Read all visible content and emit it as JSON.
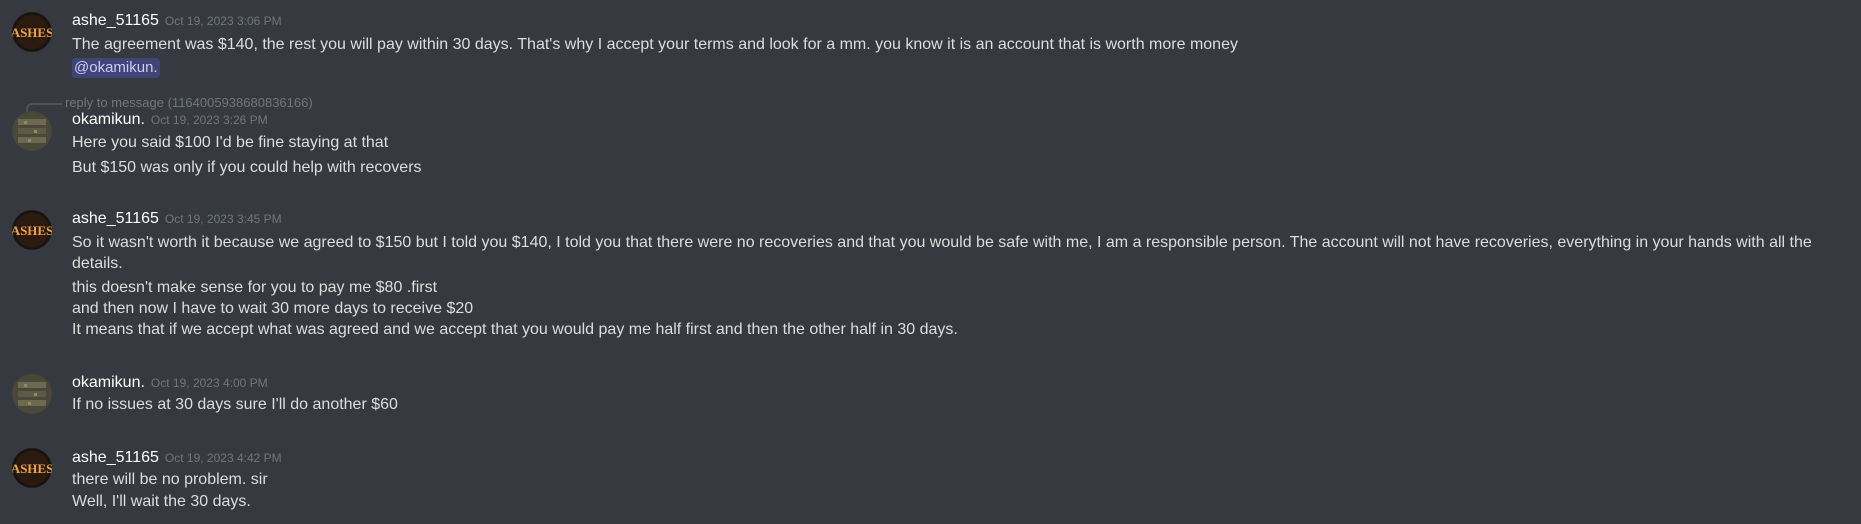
{
  "colors": {
    "background": "#36393f",
    "username": "#ffffff",
    "timestamp": "#72767d",
    "message_text": "#dcddde",
    "mention_background": "#3e4270",
    "mention_text": "#c9cdfb"
  },
  "messages": [
    {
      "author": "ashe_51165",
      "avatar_icon": "ashes-logo-avatar",
      "timestamp": "Oct 19, 2023 3:06 PM",
      "lines": [
        "The agreement was $140, the rest you will pay within 30 days. That's why I accept your terms and look for a mm. you know it is an account that is worth more money"
      ],
      "mention": "@okamikun."
    },
    {
      "author": "okamikun.",
      "avatar_icon": "shelf-photo-avatar",
      "reply_label": "reply to message (1164005938680836166)",
      "timestamp": "Oct 19, 2023 3:26 PM",
      "lines": [
        "Here you said $100 I'd be fine staying at that",
        "But $150 was only if you could help with recovers"
      ]
    },
    {
      "author": "ashe_51165",
      "avatar_icon": "ashes-logo-avatar",
      "timestamp": "Oct 19, 2023 3:45 PM",
      "lines": [
        "So it wasn't worth it because we agreed to $150 but I told you $140, I told you that there were no recoveries and that you would be safe with me, I am a responsible person. The account will not have recoveries, everything in your hands with all the details.",
        "this doesn't make sense for you to pay me $80 .first",
        "and then now I have to wait 30 more days to receive $20",
        "It means that if we accept what was agreed and we accept that you would pay me half first and then the other half in 30 days."
      ]
    },
    {
      "author": "okamikun.",
      "avatar_icon": "shelf-photo-avatar",
      "timestamp": "Oct 19, 2023 4:00 PM",
      "lines": [
        "If no issues at 30 days sure I'll do another $60"
      ]
    },
    {
      "author": "ashe_51165",
      "avatar_icon": "ashes-logo-avatar",
      "timestamp": "Oct 19, 2023 4:42 PM",
      "lines": [
        "there will be no problem. sir",
        "Well, I'll wait the 30 days."
      ]
    }
  ]
}
